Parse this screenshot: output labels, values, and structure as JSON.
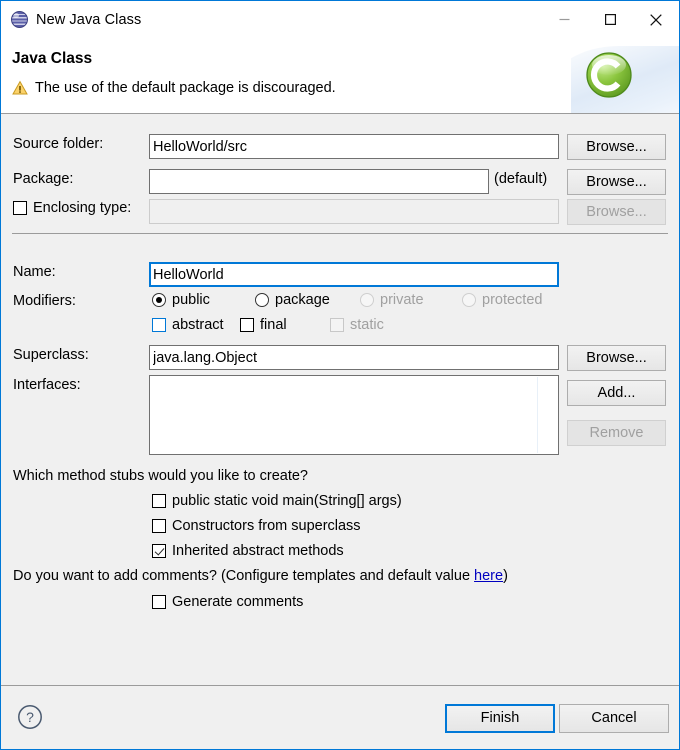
{
  "window": {
    "title": "New Java Class",
    "icon": "java-sphere-icon",
    "controls": {
      "minimize_label": "Minimize",
      "maximize_label": "Maximize",
      "close_label": "Close"
    }
  },
  "banner": {
    "title": "Java Class",
    "message": "The use of the default package is discouraged.",
    "message_icon": "warning-icon",
    "art_icon": "java-class-green-c-icon"
  },
  "form": {
    "source_folder": {
      "label": "Source folder:",
      "value": "HelloWorld/src",
      "browse_label": "Browse..."
    },
    "package": {
      "label": "Package:",
      "value": "",
      "suffix": "(default)",
      "browse_label": "Browse..."
    },
    "enclosing_type": {
      "label": "Enclosing type:",
      "checked": false,
      "value": "",
      "enabled": false,
      "browse_label": "Browse..."
    },
    "name": {
      "label": "Name:",
      "value": "HelloWorld",
      "focused": true
    },
    "modifiers": {
      "label": "Modifiers:",
      "access": [
        {
          "label": "public",
          "selected": true,
          "enabled": true
        },
        {
          "label": "package",
          "selected": false,
          "enabled": true
        },
        {
          "label": "private",
          "selected": false,
          "enabled": false
        },
        {
          "label": "protected",
          "selected": false,
          "enabled": false
        }
      ],
      "flags": [
        {
          "label": "abstract",
          "checked": false,
          "enabled": true,
          "focused": true
        },
        {
          "label": "final",
          "checked": false,
          "enabled": true,
          "focused": false
        },
        {
          "label": "static",
          "checked": false,
          "enabled": false,
          "focused": false
        }
      ]
    },
    "superclass": {
      "label": "Superclass:",
      "value": "java.lang.Object",
      "browse_label": "Browse..."
    },
    "interfaces": {
      "label": "Interfaces:",
      "items": [],
      "add_label": "Add...",
      "remove_label": "Remove",
      "remove_enabled": false
    }
  },
  "stubs": {
    "question": "Which method stubs would you like to create?",
    "options": [
      {
        "label": "public static void main(String[] args)",
        "checked": false
      },
      {
        "label": "Constructors from superclass",
        "checked": false
      },
      {
        "label": "Inherited abstract methods",
        "checked": true
      }
    ]
  },
  "comments": {
    "question_prefix": "Do you want to add comments? (Configure templates and default value ",
    "link_text": "here",
    "question_suffix": ")",
    "option": {
      "label": "Generate comments",
      "checked": false
    }
  },
  "footer": {
    "help_icon": "help-question-icon",
    "finish_label": "Finish",
    "cancel_label": "Cancel"
  },
  "colors": {
    "accent": "#0078d7",
    "dialog_bg": "#f0f0f0",
    "banner_bg": "#ffffff",
    "warning": "#e8b33c",
    "link": "#0000c0",
    "green_icon": "#7ec13d"
  }
}
